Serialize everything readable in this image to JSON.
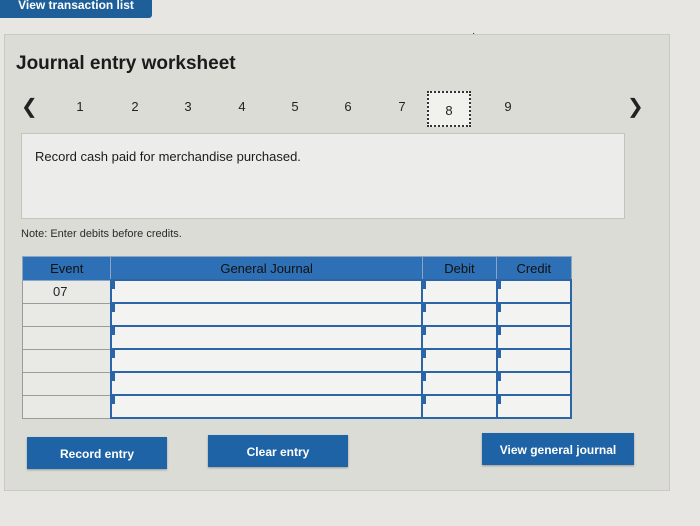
{
  "top_tab": {
    "label": "View transaction list"
  },
  "worksheet": {
    "title": "Journal entry worksheet",
    "pager": {
      "prev_icon": "chevron-left-icon",
      "next_icon": "chevron-right-icon",
      "pages": [
        "1",
        "2",
        "3",
        "4",
        "5",
        "6",
        "7",
        "8",
        "9"
      ],
      "active_page": "8"
    },
    "instruction": "Record cash paid for merchandise purchased.",
    "note": "Note: Enter debits before credits.",
    "table": {
      "headers": [
        "Event",
        "General Journal",
        "Debit",
        "Credit"
      ],
      "rows": [
        {
          "event": "07"
        },
        {
          "event": ""
        },
        {
          "event": ""
        },
        {
          "event": ""
        },
        {
          "event": ""
        },
        {
          "event": ""
        }
      ]
    },
    "buttons": {
      "record": "Record entry",
      "clear": "Clear entry",
      "view_journal": "View general journal"
    }
  },
  "colors": {
    "accent": "#1e63a6",
    "header_blue": "#2e70b5",
    "panel_bg": "#dcdcd7"
  }
}
